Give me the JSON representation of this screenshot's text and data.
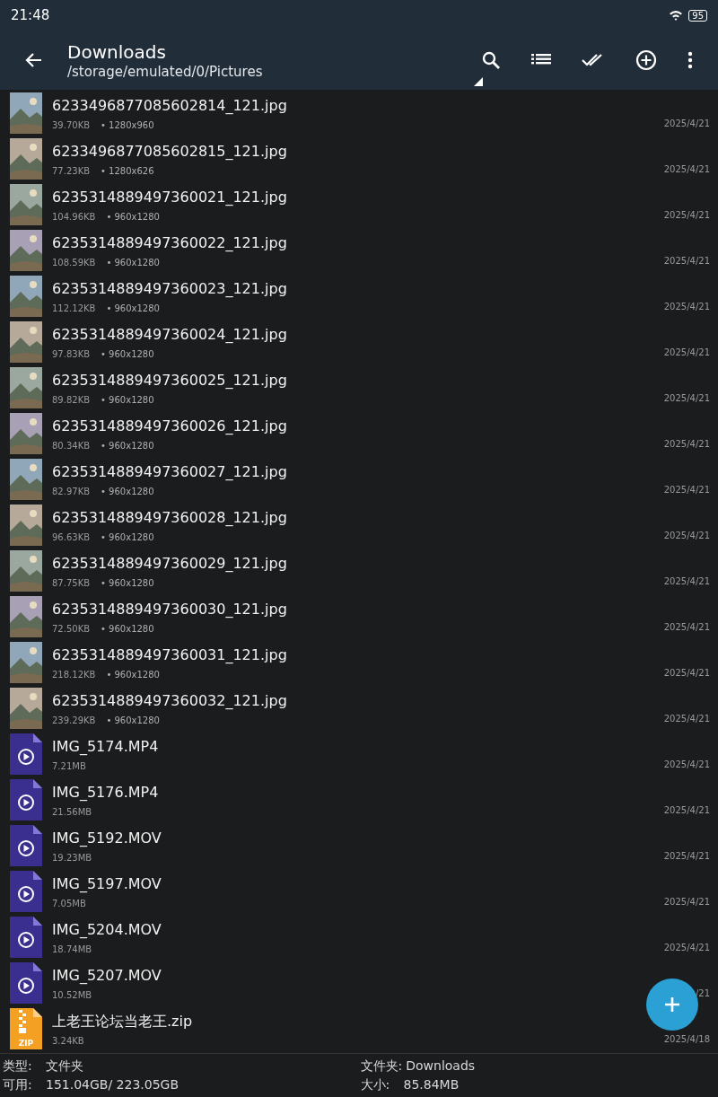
{
  "status_bar": {
    "time": "21:48",
    "battery": "95"
  },
  "app_bar": {
    "title": "Downloads",
    "path": "/storage/emulated/0/Pictures"
  },
  "files": [
    {
      "name": "6233496877085602814_121.jpg",
      "size": "39.70KB",
      "dimensions": "• 1280x960",
      "date": "2025/4/21"
    },
    {
      "name": "6233496877085602815_121.jpg",
      "size": "77.23KB",
      "dimensions": "• 1280x626",
      "date": "2025/4/21"
    },
    {
      "name": "6235314889497360021_121.jpg",
      "size": "104.96KB",
      "dimensions": "• 960x1280",
      "date": "2025/4/21"
    },
    {
      "name": "6235314889497360022_121.jpg",
      "size": "108.59KB",
      "dimensions": "• 960x1280",
      "date": "2025/4/21"
    },
    {
      "name": "6235314889497360023_121.jpg",
      "size": "112.12KB",
      "dimensions": "• 960x1280",
      "date": "2025/4/21"
    },
    {
      "name": "6235314889497360024_121.jpg",
      "size": "97.83KB",
      "dimensions": "• 960x1280",
      "date": "2025/4/21"
    },
    {
      "name": "6235314889497360025_121.jpg",
      "size": "89.82KB",
      "dimensions": "• 960x1280",
      "date": "2025/4/21"
    },
    {
      "name": "6235314889497360026_121.jpg",
      "size": "80.34KB",
      "dimensions": "• 960x1280",
      "date": "2025/4/21"
    },
    {
      "name": "6235314889497360027_121.jpg",
      "size": "82.97KB",
      "dimensions": "• 960x1280",
      "date": "2025/4/21"
    },
    {
      "name": "6235314889497360028_121.jpg",
      "size": "96.63KB",
      "dimensions": "• 960x1280",
      "date": "2025/4/21"
    },
    {
      "name": "6235314889497360029_121.jpg",
      "size": "87.75KB",
      "dimensions": "• 960x1280",
      "date": "2025/4/21"
    },
    {
      "name": "6235314889497360030_121.jpg",
      "size": "72.50KB",
      "dimensions": "• 960x1280",
      "date": "2025/4/21"
    },
    {
      "name": "6235314889497360031_121.jpg",
      "size": "218.12KB",
      "dimensions": "• 960x1280",
      "date": "2025/4/21"
    },
    {
      "name": "6235314889497360032_121.jpg",
      "size": "239.29KB",
      "dimensions": "• 960x1280",
      "date": "2025/4/21"
    },
    {
      "kind": "video",
      "name": "IMG_5174.MP4",
      "size": "7.21MB",
      "date": "2025/4/21"
    },
    {
      "kind": "video",
      "name": "IMG_5176.MP4",
      "size": "21.56MB",
      "date": "2025/4/21"
    },
    {
      "kind": "video",
      "name": "IMG_5192.MOV",
      "size": "19.23MB",
      "date": "2025/4/21"
    },
    {
      "kind": "video",
      "name": "IMG_5197.MOV",
      "size": "7.05MB",
      "date": "2025/4/21"
    },
    {
      "kind": "video",
      "name": "IMG_5204.MOV",
      "size": "18.74MB",
      "date": "2025/4/21"
    },
    {
      "kind": "video",
      "name": "IMG_5207.MOV",
      "size": "10.52MB",
      "date": "/21"
    },
    {
      "kind": "zip",
      "name": "上老王论坛当老王.zip",
      "size": "3.24KB",
      "date": "2025/4/18",
      "badge": "ZIP"
    }
  ],
  "footer": {
    "type_label": "类型:",
    "type_value": "文件夹",
    "free_label": "可用:",
    "free_value": "151.04GB/ 223.05GB",
    "folder_label": "文件夹:",
    "folder_value": "Downloads",
    "size_label": "大小:",
    "size_value": "85.84MB"
  }
}
